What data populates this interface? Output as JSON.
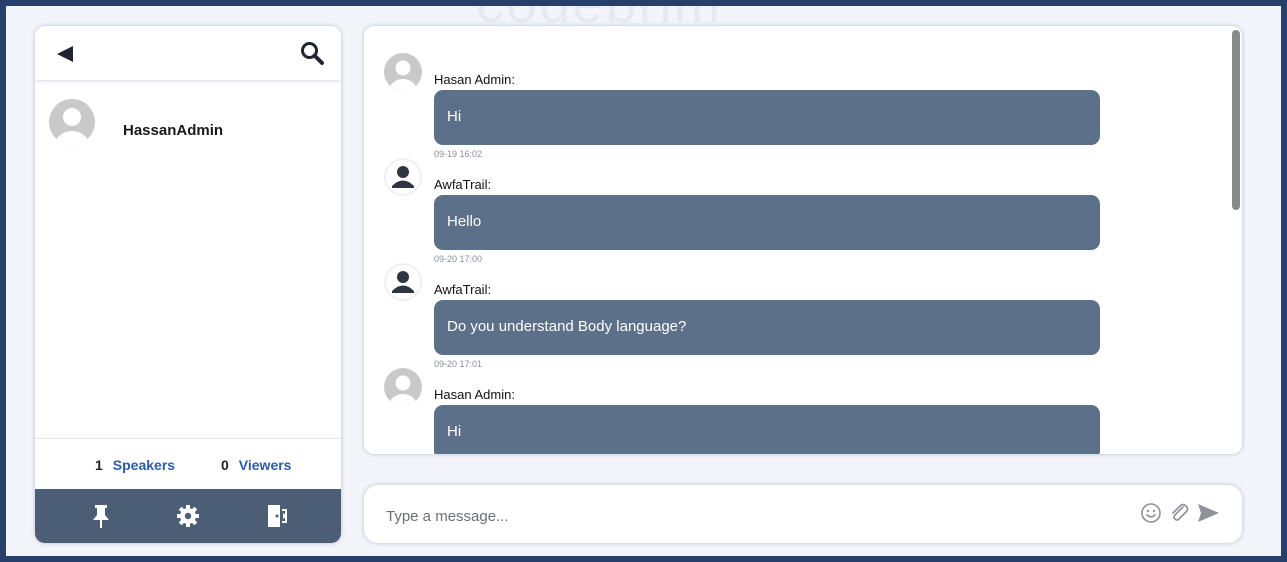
{
  "watermark": "codebrim",
  "left_panel": {
    "user": {
      "name": "HassanAdmin",
      "avatar": "user-avatar-default"
    },
    "speakers_count": "1",
    "speakers_label": "Speakers",
    "viewers_count": "0",
    "viewers_label": "Viewers",
    "header_icons": [
      "back-arrow-icon",
      "search-icon"
    ],
    "footer_icons": [
      "pin-icon",
      "gear-icon",
      "exit-door-icon"
    ]
  },
  "messages": [
    {
      "sender": "Hasan Admin:",
      "text": "Hi",
      "time": "09-19 16:02",
      "avatar": "default-avatar"
    },
    {
      "sender": "AwfaTrail:",
      "text": "Hello",
      "time": "09-20 17:00",
      "avatar": "person-avatar"
    },
    {
      "sender": "AwfaTrail:",
      "text": "Do you understand Body language?",
      "time": "09-20 17:01",
      "avatar": "person-avatar"
    },
    {
      "sender": "Hasan Admin:",
      "text": "Hi",
      "time": "",
      "avatar": "default-avatar"
    }
  ],
  "composer": {
    "placeholder": "Type a message...",
    "icons": [
      "emoji-icon",
      "attach-icon",
      "send-icon"
    ]
  },
  "colors": {
    "border": "#27406b",
    "bubble": "#5d7089",
    "footer": "#4c5d76",
    "link": "#2a5ca8"
  }
}
